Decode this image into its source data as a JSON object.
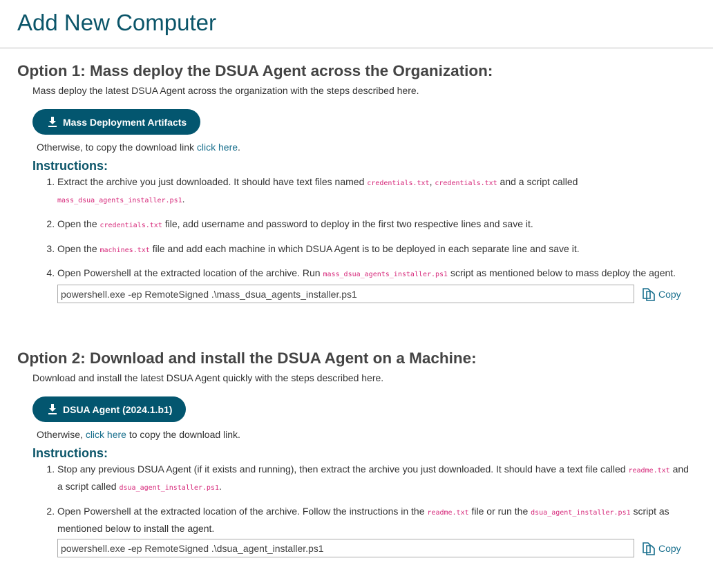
{
  "page_title": "Add New Computer",
  "option1": {
    "heading": "Option 1: Mass deploy the DSUA Agent across the Organization:",
    "description": "Mass deploy the latest DSUA Agent across the organization with the steps described here.",
    "button_label": "Mass Deployment Artifacts",
    "other_prefix": "Otherwise, to copy the download link ",
    "other_link": "click here",
    "other_suffix": ".",
    "instructions_heading": "Instructions:",
    "steps": [
      {
        "a": "Extract the archive you just downloaded. It should have text files named ",
        "c1": "credentials.txt",
        "b": ", ",
        "c2": "credentials.txt",
        "d": " and a script called ",
        "c3": "mass_dsua_agents_installer.ps1",
        "e": "."
      },
      {
        "a": "Open the ",
        "c1": "credentials.txt",
        "b": " file, add username and password to deploy in the first two respective lines and save it."
      },
      {
        "a": "Open the ",
        "c1": "machines.txt",
        "b": " file and add each machine in which DSUA Agent is to be deployed in each separate line and save it."
      },
      {
        "a": "Open Powershell at the extracted location of the archive. Run ",
        "c1": "mass_dsua_agents_installer.ps1",
        "b": " script as mentioned below to mass deploy the agent."
      }
    ],
    "command": "powershell.exe -ep RemoteSigned .\\mass_dsua_agents_installer.ps1",
    "copy_label": "Copy"
  },
  "option2": {
    "heading": "Option 2: Download and install the DSUA Agent on a Machine:",
    "description": "Download and install the latest DSUA Agent quickly with the steps described here.",
    "button_label": "DSUA Agent (2024.1.b1)",
    "other_prefix": "Otherwise, ",
    "other_link": "click here",
    "other_suffix": " to copy the download link.",
    "instructions_heading": "Instructions:",
    "steps": [
      {
        "a": "Stop any previous DSUA Agent (if it exists and running), then extract the archive you just downloaded. It should have a text file called ",
        "c1": "readme.txt",
        "b": " and a script called ",
        "c2": "dsua_agent_installer.ps1",
        "d": "."
      },
      {
        "a": "Open Powershell at the extracted location of the archive. Follow the instructions in the ",
        "c1": "readme.txt",
        "b": " file or run the ",
        "c2": "dsua_agent_installer.ps1",
        "d": " script as mentioned below to install the agent."
      }
    ],
    "command": "powershell.exe -ep RemoteSigned .\\dsua_agent_installer.ps1",
    "copy_label": "Copy"
  }
}
